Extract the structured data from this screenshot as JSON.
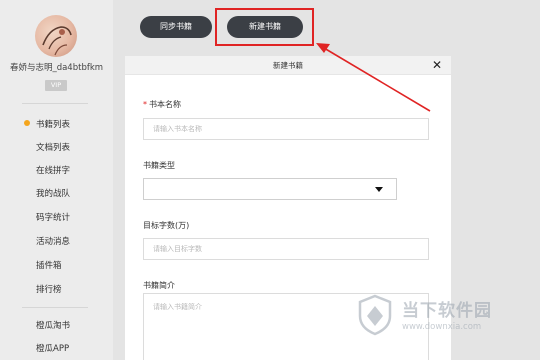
{
  "user": {
    "name": "春娇与志明_da4btbfkm",
    "badge": "VIP"
  },
  "sidebar": {
    "items": [
      {
        "label": "书籍列表",
        "active": true
      },
      {
        "label": "文档列表"
      },
      {
        "label": "在线拼字"
      },
      {
        "label": "我的战队"
      },
      {
        "label": "码字统计"
      },
      {
        "label": "活动消息"
      },
      {
        "label": "插件箱"
      },
      {
        "label": "排行榜"
      }
    ],
    "bottom_items": [
      {
        "label": "橙瓜淘书"
      },
      {
        "label": "橙瓜APP"
      }
    ],
    "active_dot_color": "#f4a51c"
  },
  "toolbar": {
    "sync_label": "同步书籍",
    "new_label": "新建书籍"
  },
  "modal": {
    "title": "新建书籍",
    "close_glyph": "✕",
    "fields": {
      "name": {
        "required_mark": "*",
        "label": "书本名称",
        "placeholder": "请输入书本名称",
        "value": ""
      },
      "type": {
        "label": "书籍类型",
        "value": ""
      },
      "target": {
        "label": "目标字数(万)",
        "placeholder": "请输入目标字数",
        "value": ""
      },
      "intro": {
        "label": "书籍简介",
        "placeholder": "请输入书籍简介",
        "value": ""
      }
    }
  },
  "annotation": {
    "highlight_color": "#e02424"
  },
  "watermark": {
    "name": "当下软件园",
    "url": "www.downxia.com"
  }
}
